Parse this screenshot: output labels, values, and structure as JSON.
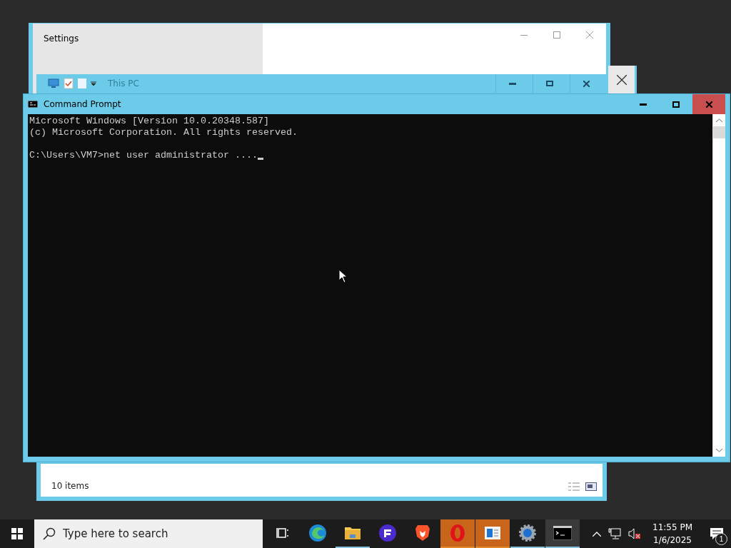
{
  "settings_window": {
    "title": "Settings"
  },
  "explorer_window": {
    "title": "This PC",
    "status": "10 items"
  },
  "cmd_window": {
    "title": "Command Prompt",
    "blocks": [
      {
        "lines": [
          "Microsoft Windows [Version 10.0.20348.587]",
          "(c) Microsoft Corporation. All rights reserved."
        ]
      },
      {
        "lines": [
          "C:\\Users\\VM7>net user administrator ...."
        ]
      }
    ],
    "cursor": true
  },
  "taskbar": {
    "search": {
      "placeholder": "Type here to search"
    },
    "apps": [
      {
        "kind": "taskview",
        "running": false,
        "flashing": false,
        "selected": false
      },
      {
        "kind": "edge",
        "running": false,
        "flashing": false,
        "selected": false
      },
      {
        "kind": "folder",
        "running": true,
        "flashing": false,
        "selected": false
      },
      {
        "kind": "fapp",
        "running": false,
        "flashing": false,
        "selected": false
      },
      {
        "kind": "brave",
        "running": false,
        "flashing": false,
        "selected": false
      },
      {
        "kind": "opera",
        "running": true,
        "flashing": true,
        "selected": false
      },
      {
        "kind": "panel",
        "running": true,
        "flashing": true,
        "selected": false
      },
      {
        "kind": "gear",
        "running": true,
        "flashing": false,
        "selected": false
      },
      {
        "kind": "terminal",
        "running": true,
        "flashing": false,
        "selected": true
      }
    ],
    "clock": {
      "time": "11:55 PM",
      "date": "1/6/2025"
    },
    "notifications": {
      "count": "1"
    }
  }
}
